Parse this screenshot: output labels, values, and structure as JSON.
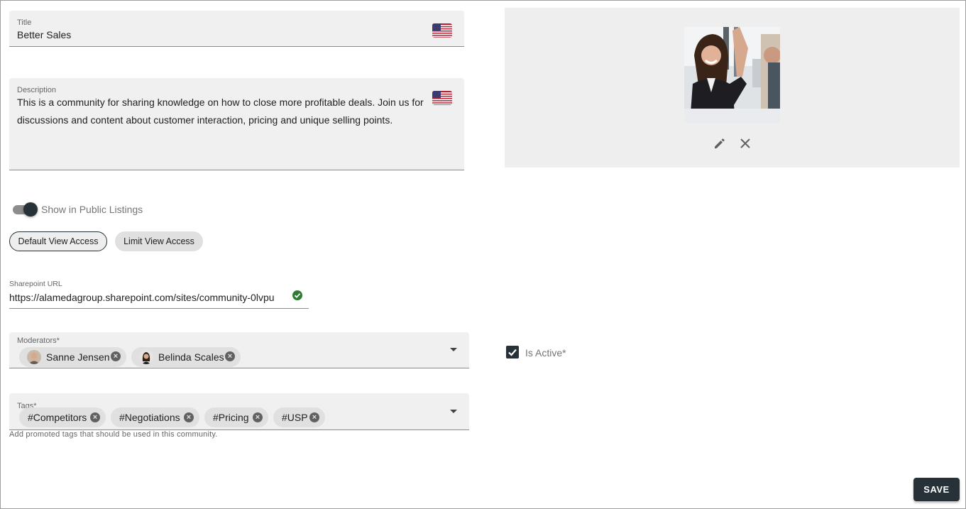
{
  "title_field": {
    "label": "Title",
    "value": "Better Sales",
    "flag": "us-flag-icon"
  },
  "description_field": {
    "label": "Description",
    "value": "This is a community for sharing knowledge on how to close more profitable deals. Join us for discussions and content about customer interaction, pricing and unique selling points.",
    "flag": "us-flag-icon"
  },
  "public_listing": {
    "label": "Show in Public Listings",
    "enabled": true
  },
  "view_access": {
    "options": [
      "Default View Access",
      "Limit View Access"
    ],
    "selected": "Default View Access"
  },
  "sharepoint": {
    "label": "Sharepoint URL",
    "value": "https://alamedagroup.sharepoint.com/sites/community-0lvpu",
    "status_icon": "check-circle-icon"
  },
  "moderators": {
    "label": "Moderators*",
    "items": [
      {
        "name": "Sanne Jensen"
      },
      {
        "name": "Belinda Scales"
      }
    ]
  },
  "tags": {
    "label": "Tags*",
    "items": [
      "#Competitors",
      "#Negotiations",
      "#Pricing",
      "#USP"
    ],
    "helper": "Add promoted tags that should be used in this community."
  },
  "image": {
    "edit_icon": "pencil-icon",
    "remove_icon": "close-icon"
  },
  "is_active": {
    "label": "Is Active*",
    "checked": true
  },
  "save_label": "SAVE",
  "colors": {
    "primary": "#263238",
    "field_bg": "#f0f0f0",
    "chip_bg": "#e0e0e0",
    "success": "#2e7d32"
  }
}
